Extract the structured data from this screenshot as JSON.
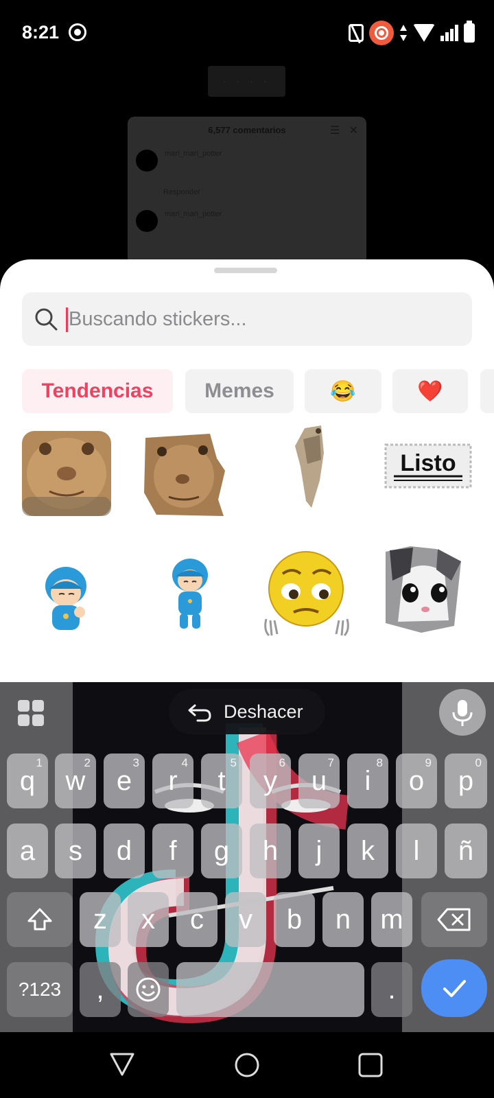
{
  "status_bar": {
    "time": "8:21"
  },
  "background": {
    "pill_text": "· · · ·",
    "comments_title": "6,577 comentarios",
    "comment_user_1": "mari_mari_potter",
    "reply_label": "Responder",
    "comment_user_2": "mari_mari_potter"
  },
  "sticker_panel": {
    "search": {
      "placeholder": "Buscando stickers..."
    },
    "tabs": [
      {
        "label": "Tendencias",
        "active": true
      },
      {
        "label": "Memes",
        "active": false
      },
      {
        "label": "😂",
        "active": false
      },
      {
        "label": "❤️",
        "active": false
      }
    ],
    "stickers": [
      {
        "name": "cat-face-closeup",
        "text": ""
      },
      {
        "name": "cat-face-cutout",
        "text": ""
      },
      {
        "name": "standing-cat",
        "text": ""
      },
      {
        "name": "listo-stamp",
        "text": "Listo"
      },
      {
        "name": "pocoyo-waving",
        "text": ""
      },
      {
        "name": "pocoyo-standing",
        "text": ""
      },
      {
        "name": "sad-emoji-hands",
        "text": ""
      },
      {
        "name": "crying-kitten",
        "text": ""
      }
    ]
  },
  "keyboard": {
    "undo_label": "Deshacer",
    "row1": [
      {
        "k": "q",
        "h": "1"
      },
      {
        "k": "w",
        "h": "2"
      },
      {
        "k": "e",
        "h": "3"
      },
      {
        "k": "r",
        "h": "4"
      },
      {
        "k": "t",
        "h": "5"
      },
      {
        "k": "y",
        "h": "6"
      },
      {
        "k": "u",
        "h": "7"
      },
      {
        "k": "i",
        "h": "8"
      },
      {
        "k": "o",
        "h": "9"
      },
      {
        "k": "p",
        "h": "0"
      }
    ],
    "row2": [
      "a",
      "s",
      "d",
      "f",
      "g",
      "h",
      "j",
      "k",
      "l",
      "ñ"
    ],
    "row3": [
      "z",
      "x",
      "c",
      "v",
      "b",
      "n",
      "m"
    ],
    "symbols_label": "?123",
    "comma_label": ",",
    "period_label": "."
  },
  "colors": {
    "accent": "#ee4260",
    "active_tab_bg": "#fdeff2",
    "enter_key": "#4d8ef5"
  }
}
